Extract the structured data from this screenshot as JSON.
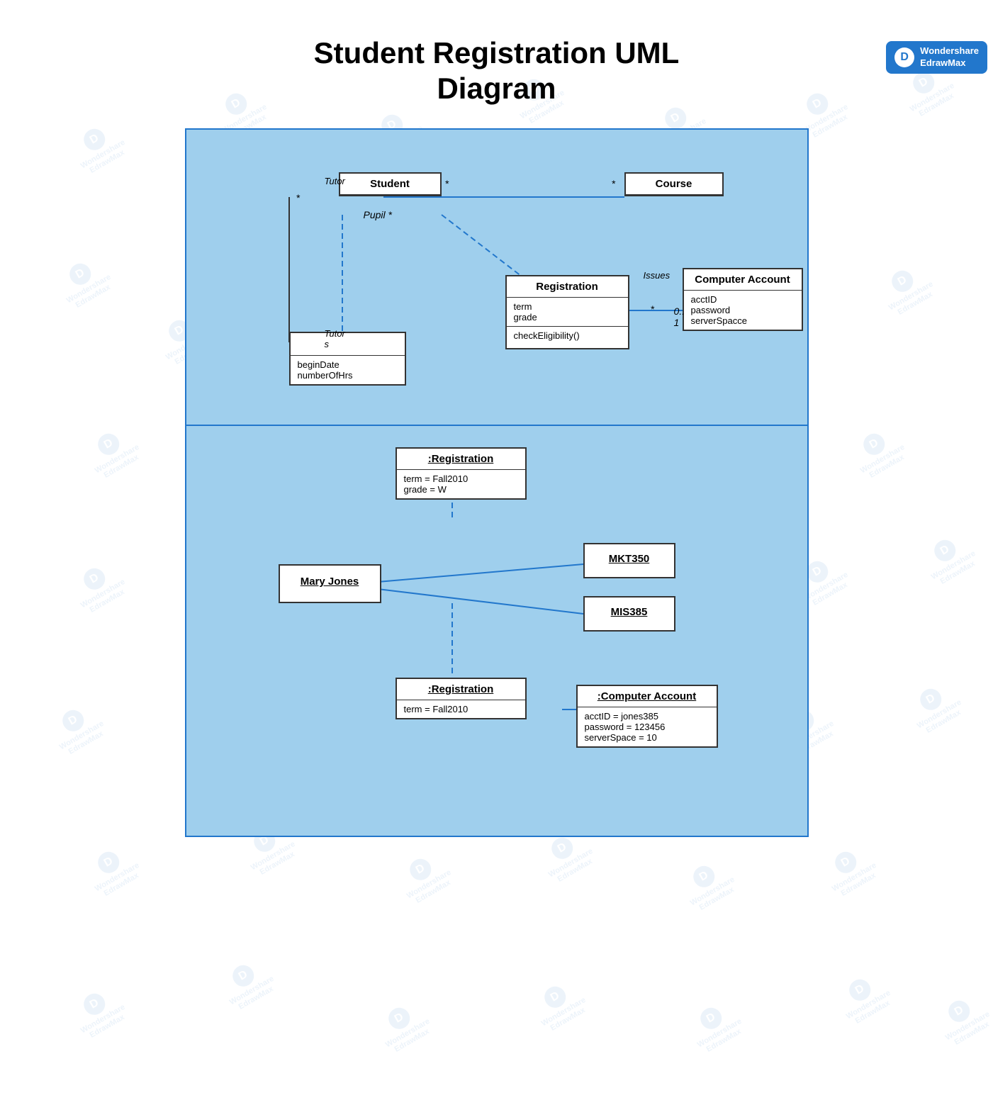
{
  "brand": {
    "icon": "D",
    "line1": "Wondershare",
    "line2": "EdrawMax"
  },
  "title": "Student Registration UML\nDiagram",
  "top_panel": {
    "classes": {
      "student": {
        "name": "Student",
        "sections": []
      },
      "course": {
        "name": "Course",
        "sections": []
      },
      "registration": {
        "name": "Registration",
        "attributes": [
          "term",
          "grade"
        ],
        "methods": [
          "checkEligibility()"
        ]
      },
      "computer_account": {
        "name": "Computer Account",
        "attributes": [
          "acctID",
          "password",
          "serverSpacce"
        ]
      },
      "tutor_unnamed": {
        "attributes": [
          "beginDate",
          "numberOfHrs"
        ]
      }
    },
    "relationships": {
      "student_course": {
        "from": "Student",
        "to": "Course",
        "from_mult": "*",
        "to_mult": "*"
      },
      "student_registration": {
        "from": "Student",
        "to": "Registration",
        "dashed": true
      },
      "registration_computer": {
        "from": "Registration",
        "to": "Computer Account",
        "from_mult": "*",
        "to_mult_low": "0..1",
        "label": "Issues"
      },
      "student_tutor": {
        "label_top": "Tutor",
        "label_bottom": "Tutors",
        "mult_top": "*",
        "mult_bottom": "*",
        "pupil": "Pupil *"
      }
    }
  },
  "bottom_panel": {
    "objects": {
      "mary_jones": {
        "name": "Mary Jones"
      },
      "registration1": {
        "name": ":Registration",
        "attrs": [
          "term = Fall2010",
          "grade = W"
        ]
      },
      "registration2": {
        "name": ":Registration",
        "attrs": [
          "term = Fall2010"
        ]
      },
      "mkt350": {
        "name": "MKT350"
      },
      "mis385": {
        "name": "MIS385"
      },
      "computer_account": {
        "name": ":Computer Account",
        "attrs": [
          "acctID = jones385",
          "password = 123456",
          "serverSpace = 10"
        ]
      }
    }
  }
}
